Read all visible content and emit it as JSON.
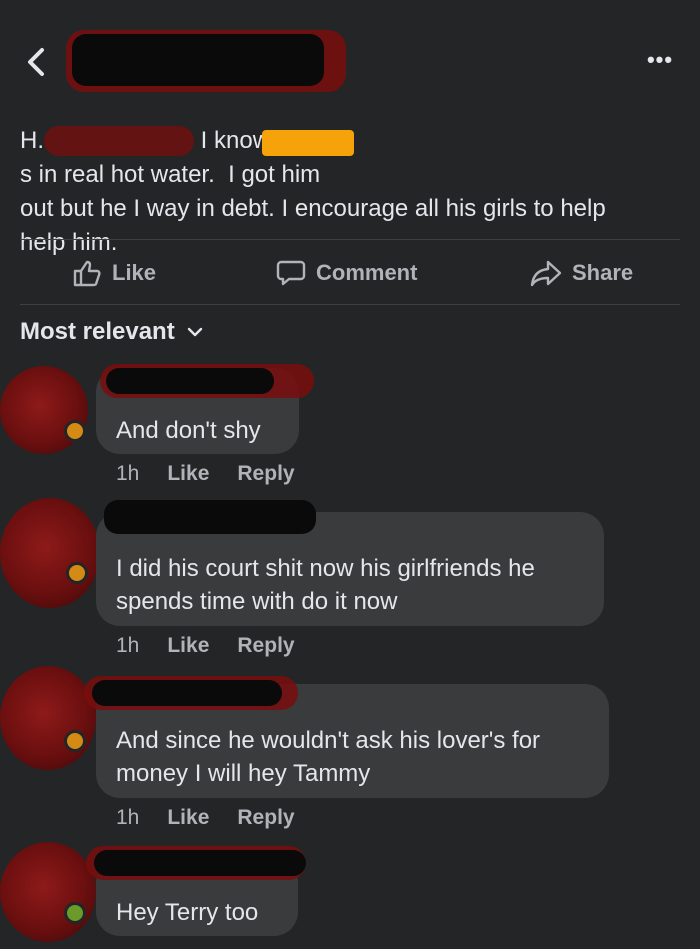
{
  "header": {
    "more_label": "•••"
  },
  "post": {
    "line1_a": "H. ",
    "line1_b": "I know",
    "line1_c": "s in real hot water.  I got him",
    "line2": "out but he I way in debt.  I encourage all his girls to help",
    "line3": "help him."
  },
  "actions": {
    "like": "Like",
    "comment": "Comment",
    "share": "Share"
  },
  "sort": {
    "label": "Most relevant"
  },
  "comments": [
    {
      "text": "And don't shy",
      "time": "1h",
      "like": "Like",
      "reply": "Reply"
    },
    {
      "text1": "I did his court shit now his girlfriends he",
      "text2": "spends time with do it now",
      "time": "1h",
      "like": "Like",
      "reply": "Reply"
    },
    {
      "text1": "And since he wouldn't ask his lover's for",
      "text2": "money I will hey Tammy",
      "time": "1h",
      "like": "Like",
      "reply": "Reply"
    },
    {
      "text": "Hey Terry too"
    }
  ],
  "colors": {
    "background": "#242526",
    "bubble": "#3a3b3c",
    "text": "#e4e6eb",
    "muted": "#b0b3b8",
    "redaction_orange": "#f6a20a"
  },
  "icons": [
    "back-chevron-icon",
    "more-options-icon",
    "thumbs-up-icon",
    "comment-bubble-icon",
    "share-arrow-icon",
    "chevron-down-icon"
  ]
}
